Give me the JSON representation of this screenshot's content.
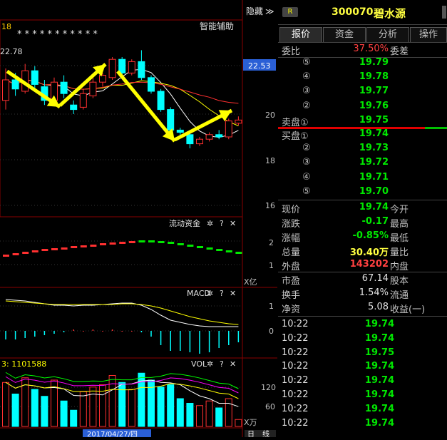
{
  "chart": {
    "top_left_label": "18",
    "hide_label": "隐藏",
    "hide_arrow": "≫",
    "assist_label": "智能辅助",
    "stars": "* *      *      * * * * *    *    * *",
    "max_label": "22.78",
    "price_tag": "22.53",
    "y_ticks": [
      "20",
      "18",
      "16"
    ],
    "flow": {
      "title": "流动资金",
      "ticks": [
        "2",
        "1"
      ],
      "unit": "X亿"
    },
    "macd": {
      "title": "MACD",
      "ticks": [
        "1",
        "0"
      ]
    },
    "vol": {
      "title": "VOL",
      "left_label": "3: 1101588",
      "ticks": [
        "120",
        "60"
      ],
      "unit": "X万"
    },
    "date_label": "2017/04/27/四",
    "period_labels": [
      "日",
      "线"
    ],
    "ctrl_icons": {
      "gear": "✲",
      "help": "?",
      "close": "✕"
    }
  },
  "quote": {
    "badge": "R",
    "code": "300070",
    "name": "碧水源",
    "tabs": [
      "报价",
      "资金",
      "分析",
      "操作"
    ],
    "weibi_label": "委比",
    "weibi_value": "37.50%",
    "weicha_label": "委差",
    "sell_levels": [
      {
        "label": "⑤",
        "price": "19.79"
      },
      {
        "label": "④",
        "price": "19.78"
      },
      {
        "label": "③",
        "price": "19.77"
      },
      {
        "label": "②",
        "price": "19.76"
      },
      {
        "label": "卖盘①",
        "price": "19.75"
      }
    ],
    "buy_levels": [
      {
        "label": "买盘①",
        "price": "19.74"
      },
      {
        "label": "②",
        "price": "19.73"
      },
      {
        "label": "③",
        "price": "19.72"
      },
      {
        "label": "④",
        "price": "19.71"
      },
      {
        "label": "⑤",
        "price": "19.70"
      }
    ],
    "stats": [
      {
        "label": "现价",
        "value": "19.74",
        "color": "green",
        "label2": "今开"
      },
      {
        "label": "涨跌",
        "value": "-0.17",
        "color": "green",
        "label2": "最高"
      },
      {
        "label": "涨幅",
        "value": "-0.85%",
        "color": "green",
        "label2": "最低"
      },
      {
        "label": "总量",
        "value": "30.40万",
        "color": "yellow",
        "label2": "量比"
      },
      {
        "label": "外盘",
        "value": "143202",
        "color": "red",
        "label2": "内盘"
      }
    ],
    "stats2": [
      {
        "label": "市盈",
        "value": "67.14",
        "label2": "股本"
      },
      {
        "label": "换手",
        "value": "1.54%",
        "label2": "流通"
      },
      {
        "label": "净资",
        "value": "5.08",
        "label2": "收益(一)"
      }
    ],
    "ticks": [
      {
        "time": "10:22",
        "price": "19.74"
      },
      {
        "time": "10:22",
        "price": "19.74"
      },
      {
        "time": "10:22",
        "price": "19.75"
      },
      {
        "time": "10:22",
        "price": "19.74"
      },
      {
        "time": "10:22",
        "price": "19.74"
      },
      {
        "time": "10:22",
        "price": "19.74"
      },
      {
        "time": "10:22",
        "price": "19.74"
      },
      {
        "time": "10:22",
        "price": "19.74"
      }
    ]
  },
  "colors": {
    "up": "#ff3030",
    "down": "#00ffff",
    "accent": "#2a5fd6",
    "ma5": "#ffffff",
    "ma10": "#ffff00",
    "ma20": "#ff00ff",
    "ma60": "#00ff00"
  },
  "candles": [
    {
      "o": 20.6,
      "c": 21.5,
      "h": 22.0,
      "l": 20.2
    },
    {
      "o": 21.5,
      "c": 21.1,
      "h": 21.8,
      "l": 20.8
    },
    {
      "o": 21.0,
      "c": 21.9,
      "h": 22.2,
      "l": 20.9
    },
    {
      "o": 21.9,
      "c": 21.3,
      "h": 22.1,
      "l": 21.0
    },
    {
      "o": 21.2,
      "c": 20.6,
      "h": 21.5,
      "l": 20.4
    },
    {
      "o": 20.6,
      "c": 21.4,
      "h": 21.6,
      "l": 20.5
    },
    {
      "o": 21.4,
      "c": 20.9,
      "h": 21.7,
      "l": 20.7
    },
    {
      "o": 20.4,
      "c": 20.2,
      "h": 20.6,
      "l": 20.0
    },
    {
      "o": 20.3,
      "c": 20.9,
      "h": 21.1,
      "l": 20.2
    },
    {
      "o": 20.8,
      "c": 21.4,
      "h": 21.6,
      "l": 20.7
    },
    {
      "o": 21.4,
      "c": 21.7,
      "h": 21.8,
      "l": 21.2
    },
    {
      "o": 21.6,
      "c": 22.4,
      "h": 22.5,
      "l": 21.5
    },
    {
      "o": 22.4,
      "c": 21.8,
      "h": 22.5,
      "l": 21.6
    },
    {
      "o": 21.8,
      "c": 22.3,
      "h": 22.4,
      "l": 21.7
    },
    {
      "o": 22.3,
      "c": 21.6,
      "h": 22.8,
      "l": 21.5
    },
    {
      "o": 21.6,
      "c": 21.0,
      "h": 21.7,
      "l": 20.9
    },
    {
      "o": 21.0,
      "c": 20.2,
      "h": 21.1,
      "l": 20.1
    },
    {
      "o": 20.2,
      "c": 19.3,
      "h": 20.3,
      "l": 19.2
    },
    {
      "o": 19.3,
      "c": 19.2,
      "h": 19.4,
      "l": 19.0
    },
    {
      "o": 19.1,
      "c": 18.7,
      "h": 19.2,
      "l": 18.5
    },
    {
      "o": 18.7,
      "c": 18.9,
      "h": 19.0,
      "l": 18.6
    },
    {
      "o": 18.9,
      "c": 19.1,
      "h": 19.2,
      "l": 18.8
    },
    {
      "o": 19.1,
      "c": 19.0,
      "h": 19.3,
      "l": 18.9
    },
    {
      "o": 19.0,
      "c": 19.7,
      "h": 19.8,
      "l": 18.9
    },
    {
      "o": 19.6,
      "c": 19.74,
      "h": 19.9,
      "l": 19.5
    }
  ],
  "flow_series": [
    -0.1,
    0.0,
    0.1,
    0.2,
    0.3,
    0.35,
    0.4,
    0.5,
    0.55,
    0.6,
    0.7,
    0.75,
    0.8,
    0.85,
    0.9,
    0.9,
    0.85,
    0.8,
    0.7,
    0.6,
    0.5,
    0.4,
    0.3,
    0.2,
    0.1
  ],
  "macd_bars": [
    -0.3,
    -0.3,
    -0.25,
    -0.2,
    -0.15,
    -0.1,
    -0.05,
    0.05,
    0.0,
    0.05,
    0.0,
    0.05,
    0.0,
    0.0,
    -0.05,
    -0.2,
    -0.5,
    -0.7,
    -0.7,
    -0.75,
    -0.8,
    -0.75,
    -0.6,
    -0.5,
    -0.4
  ],
  "vol_series": [
    95,
    70,
    105,
    80,
    65,
    100,
    55,
    35,
    75,
    85,
    90,
    110,
    95,
    80,
    115,
    100,
    85,
    90,
    60,
    50,
    45,
    55,
    40,
    60,
    15
  ]
}
